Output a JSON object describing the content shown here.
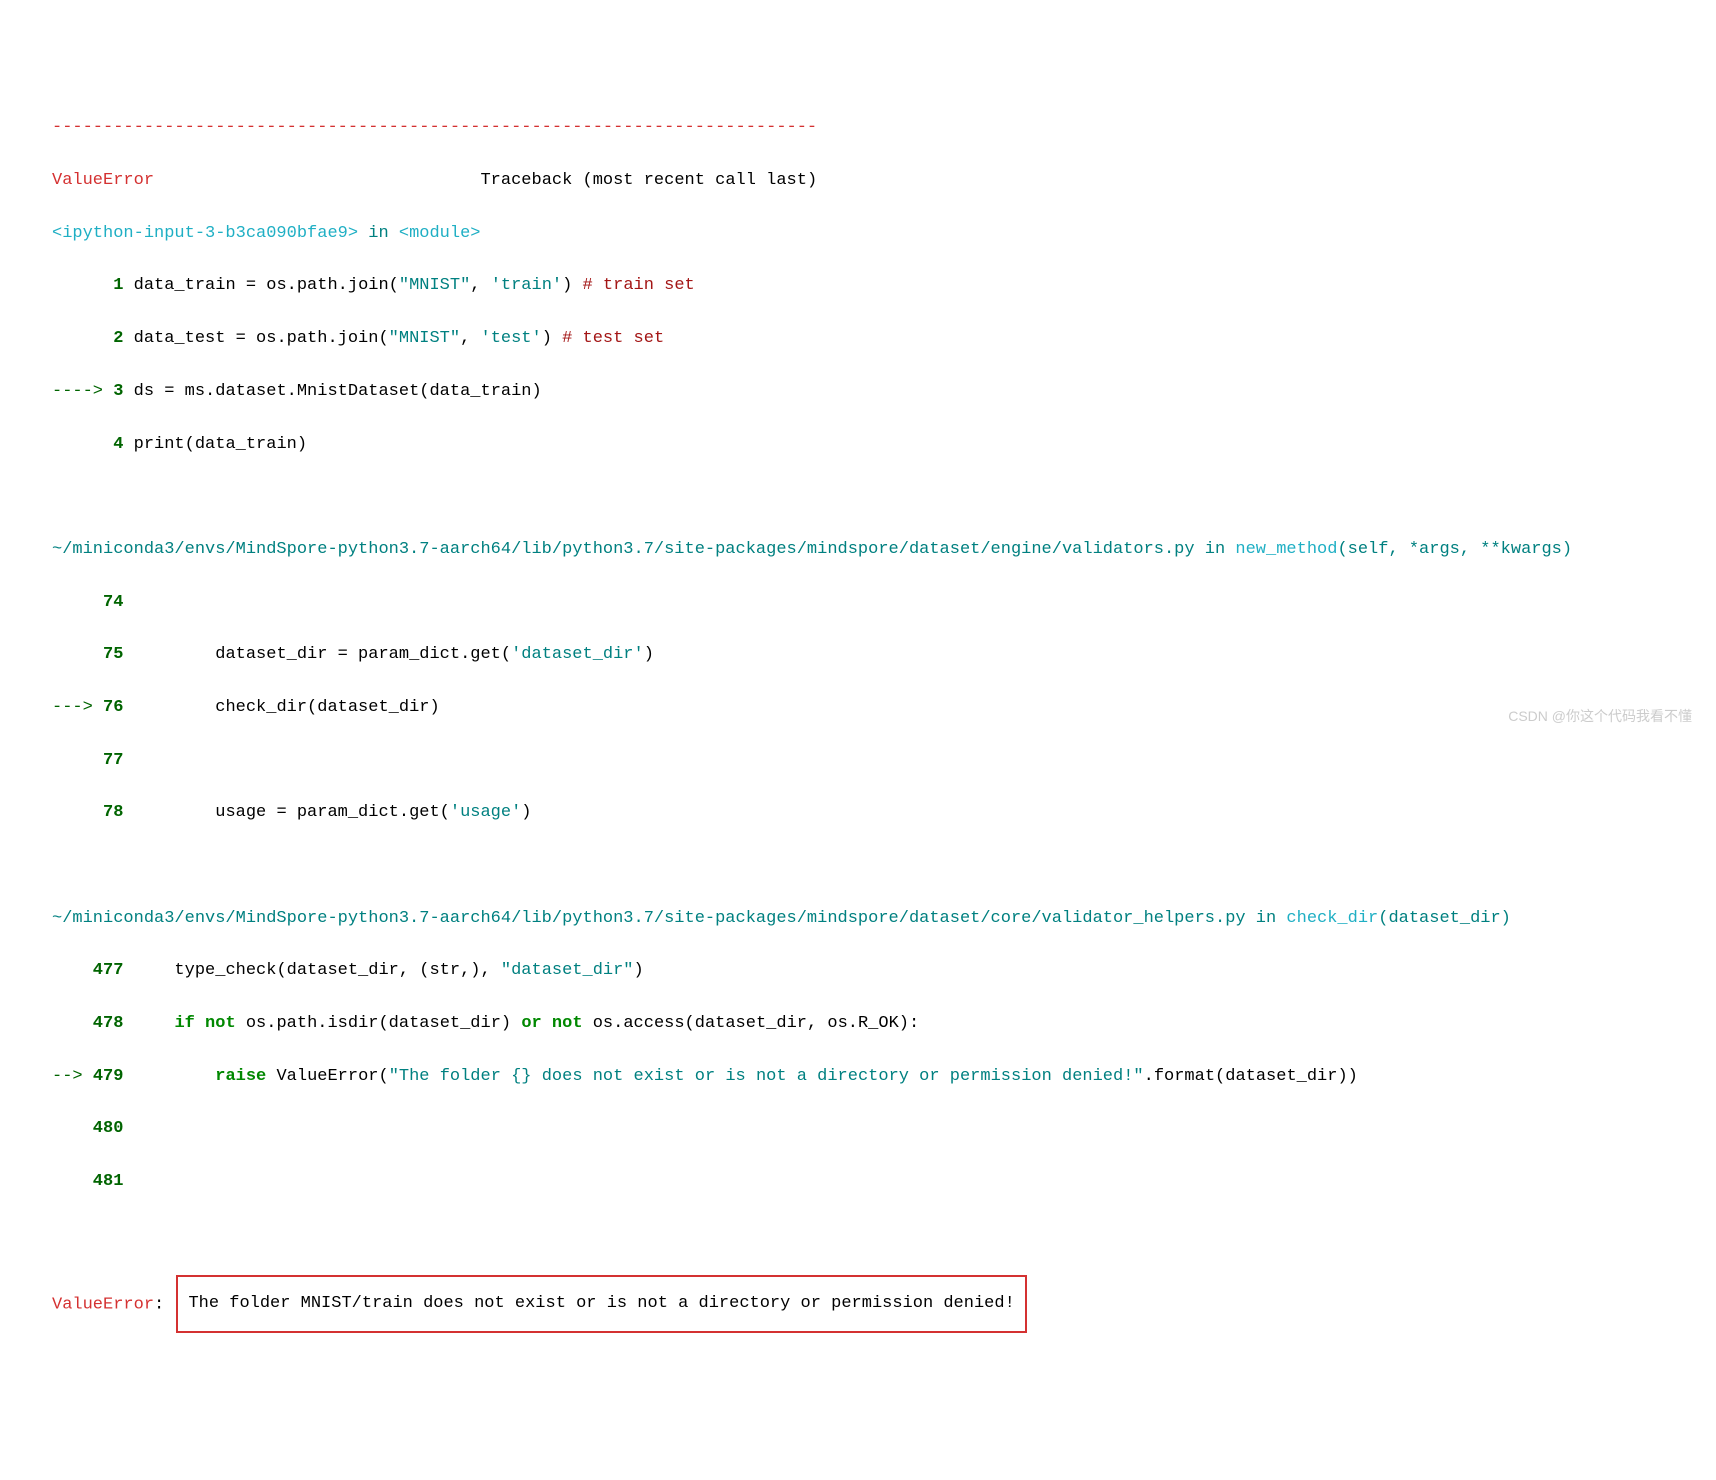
{
  "hr": "---------------------------------------------------------------------------",
  "error_name": "ValueError",
  "trace_text": "Traceback (most recent call last)",
  "f1_loc": "<ipython-input-3-b3ca090bfae9>",
  "in_word": " in ",
  "f1_func": "<module>",
  "f1_l1_num": "      1",
  "f1_l1_var": " data_train ",
  "f1_l1_op": "=",
  "f1_l1_call": " os.path.join(",
  "f1_l1_s1": "\"MNIST\"",
  "f1_l1_comma": ", ",
  "f1_l1_s2": "'train'",
  "f1_l1_close": ")",
  "f1_l1_comment": " # train set",
  "f1_l2_num": "      2",
  "f1_l2_var": " data_test ",
  "f1_l2_call": " os.path.join(",
  "f1_l2_s1": "\"MNIST\"",
  "f1_l2_s2": "'test'",
  "f1_l2_close": ")",
  "f1_l2_comment": " # test set",
  "f1_l3_arrow": "----> ",
  "f1_l3_num": "3",
  "f1_l3_code_a": " ds ",
  "f1_l3_eq": "=",
  "f1_l3_code_b": " ms.dataset.MnistDataset(data_train)",
  "f1_l4_num": "      4",
  "f1_l4_code": " print(data_train)",
  "f2_loc": "~/miniconda3/envs/MindSpore-python3.7-aarch64/lib/python3.7/site-packages/mindspore/dataset/engine/validators.py",
  "f2_func": "new_method",
  "f2_sig": "(self, *args, **kwargs)",
  "f2_l74": "     74",
  "f2_l75": "     75",
  "f2_l75_code_a": "         dataset_dir = param_dict.get(",
  "f2_l75_str": "'dataset_dir'",
  "f2_l75_code_b": ")",
  "f2_l76_arrow": "---> ",
  "f2_l76_num": "76",
  "f2_l76_code": "         check_dir(dataset_dir)",
  "f2_l77": "     77",
  "f2_l78": "     78",
  "f2_l78_code_a": "         usage = param_dict.get(",
  "f2_l78_str": "'usage'",
  "f2_l78_code_b": ")",
  "f3_loc": "~/miniconda3/envs/MindSpore-python3.7-aarch64/lib/python3.7/site-packages/mindspore/dataset/core/validator_helpers.py",
  "f3_func": "check_dir",
  "f3_sig": "(dataset_dir)",
  "f3_l477": "    477",
  "f3_l477_code_a": "     type_check(dataset_dir, (str,), ",
  "f3_l477_str": "\"dataset_dir\"",
  "f3_l477_code_b": ")",
  "f3_l478": "    478",
  "f3_l478_code_a": "     ",
  "f3_l478_if": "if",
  "f3_l478_code_b": " ",
  "f3_l478_not1": "not",
  "f3_l478_code_c": " os.path.isdir(dataset_dir) ",
  "f3_l478_or": "or",
  "f3_l478_code_d": " ",
  "f3_l478_not2": "not",
  "f3_l478_code_e": " os.access(dataset_dir, os.R_OK):",
  "f3_l479_arrow": "--> ",
  "f3_l479_num": "479",
  "f3_l479_code_a": "         ",
  "f3_l479_raise": "raise",
  "f3_l479_code_b": " ValueError(",
  "f3_l479_str": "\"The folder {} does not exist or is not a directory or permission denied!\"",
  "f3_l479_code_c": ".format(dataset_dir))",
  "f3_l480": "    480",
  "f3_l481": "    481",
  "err_label": "ValueError",
  "err_colon": ": ",
  "err_msg": "The folder MNIST/train does not exist or is not a directory or permission denied!",
  "watermark": "CSDN @你这个代码我看不懂"
}
